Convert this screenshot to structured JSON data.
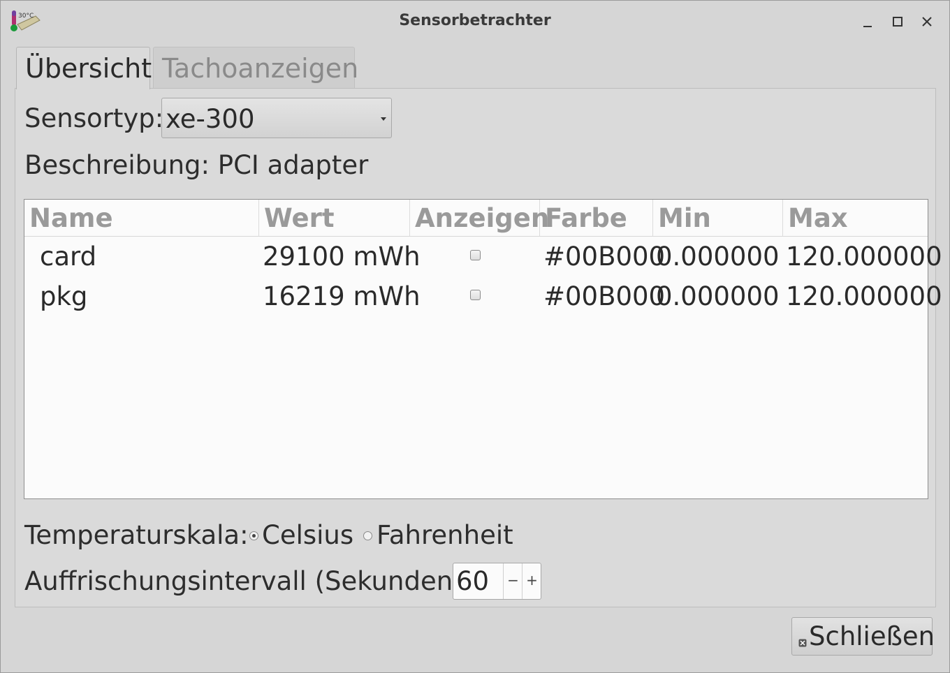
{
  "window": {
    "title": "Sensorbetrachter",
    "app_icon_text": "30°C",
    "icons": {
      "app": "thermometer-icon",
      "minimize": "minimize-icon",
      "maximize": "maximize-icon",
      "close": "close-icon"
    }
  },
  "tabs": [
    {
      "label": "Übersicht",
      "active": true
    },
    {
      "label": "Tachoanzeigen",
      "active": false
    }
  ],
  "overview": {
    "sensor_type_label": "Sensortyp:",
    "sensor_type_value": "xe-300",
    "description_label": "Beschreibung:",
    "description_value": "PCI adapter",
    "table": {
      "columns": [
        "Name",
        "Wert",
        "Anzeigen",
        "Farbe",
        "Min",
        "Max"
      ],
      "rows": [
        {
          "name": "card",
          "value": "29100 mWh",
          "show": false,
          "color": "#00B000",
          "min": "0.000000",
          "max": "120.000000"
        },
        {
          "name": "pkg",
          "value": "16219 mWh",
          "show": false,
          "color": "#00B000",
          "min": "0.000000",
          "max": "120.000000"
        }
      ]
    },
    "temperature_scale": {
      "label": "Temperaturskala:",
      "options": [
        "Celsius",
        "Fahrenheit"
      ],
      "selected": "Celsius"
    },
    "refresh_interval": {
      "label": "Auffrischungsintervall (Sekunden):",
      "value": "60",
      "minus": "−",
      "plus": "+"
    }
  },
  "footer": {
    "close_label": "Schließen"
  }
}
